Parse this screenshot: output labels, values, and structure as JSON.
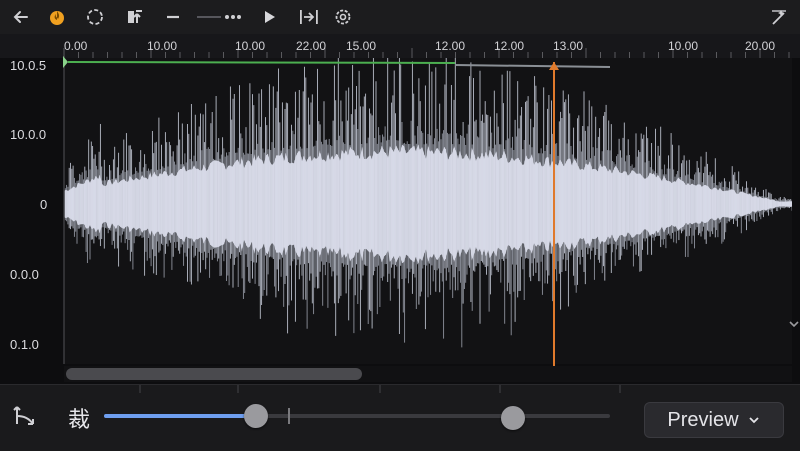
{
  "toolbar": {
    "icons": [
      "back-arrow-icon",
      "flame-icon",
      "loop-circle-icon",
      "export-icon",
      "line-dash-icon",
      "thin-line-icon",
      "dots-icon",
      "play-icon",
      "jump-to-end-icon",
      "settings-gear-icon",
      "wand-icon"
    ]
  },
  "ruler": {
    "labels": [
      "0.00",
      "10.00",
      "10.00",
      "22.00",
      "15.00",
      "12.00",
      "12.00",
      "13.00",
      "10.00",
      "20.00"
    ]
  },
  "yaxis": {
    "labels": [
      "10.0.5",
      "10.0.0",
      "0",
      "0.0.0",
      "0.1.0"
    ]
  },
  "bottom": {
    "crop_label": "裁",
    "preview_label": "Preview",
    "slider_value": 0.3
  },
  "colors": {
    "playhead": "#e07a2c",
    "selection_line": "#4caf50",
    "waveform": "#d9dcea",
    "slider_fill": "#6f9ff0"
  }
}
